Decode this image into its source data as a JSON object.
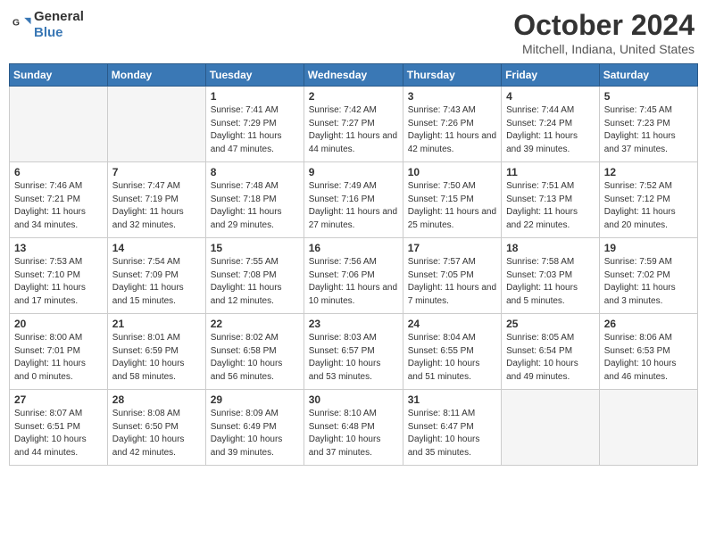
{
  "header": {
    "logo_general": "General",
    "logo_blue": "Blue",
    "title": "October 2024",
    "subtitle": "Mitchell, Indiana, United States"
  },
  "days_of_week": [
    "Sunday",
    "Monday",
    "Tuesday",
    "Wednesday",
    "Thursday",
    "Friday",
    "Saturday"
  ],
  "weeks": [
    [
      {
        "day": "",
        "sunrise": "",
        "sunset": "",
        "daylight": ""
      },
      {
        "day": "",
        "sunrise": "",
        "sunset": "",
        "daylight": ""
      },
      {
        "day": "1",
        "sunrise": "Sunrise: 7:41 AM",
        "sunset": "Sunset: 7:29 PM",
        "daylight": "Daylight: 11 hours and 47 minutes."
      },
      {
        "day": "2",
        "sunrise": "Sunrise: 7:42 AM",
        "sunset": "Sunset: 7:27 PM",
        "daylight": "Daylight: 11 hours and 44 minutes."
      },
      {
        "day": "3",
        "sunrise": "Sunrise: 7:43 AM",
        "sunset": "Sunset: 7:26 PM",
        "daylight": "Daylight: 11 hours and 42 minutes."
      },
      {
        "day": "4",
        "sunrise": "Sunrise: 7:44 AM",
        "sunset": "Sunset: 7:24 PM",
        "daylight": "Daylight: 11 hours and 39 minutes."
      },
      {
        "day": "5",
        "sunrise": "Sunrise: 7:45 AM",
        "sunset": "Sunset: 7:23 PM",
        "daylight": "Daylight: 11 hours and 37 minutes."
      }
    ],
    [
      {
        "day": "6",
        "sunrise": "Sunrise: 7:46 AM",
        "sunset": "Sunset: 7:21 PM",
        "daylight": "Daylight: 11 hours and 34 minutes."
      },
      {
        "day": "7",
        "sunrise": "Sunrise: 7:47 AM",
        "sunset": "Sunset: 7:19 PM",
        "daylight": "Daylight: 11 hours and 32 minutes."
      },
      {
        "day": "8",
        "sunrise": "Sunrise: 7:48 AM",
        "sunset": "Sunset: 7:18 PM",
        "daylight": "Daylight: 11 hours and 29 minutes."
      },
      {
        "day": "9",
        "sunrise": "Sunrise: 7:49 AM",
        "sunset": "Sunset: 7:16 PM",
        "daylight": "Daylight: 11 hours and 27 minutes."
      },
      {
        "day": "10",
        "sunrise": "Sunrise: 7:50 AM",
        "sunset": "Sunset: 7:15 PM",
        "daylight": "Daylight: 11 hours and 25 minutes."
      },
      {
        "day": "11",
        "sunrise": "Sunrise: 7:51 AM",
        "sunset": "Sunset: 7:13 PM",
        "daylight": "Daylight: 11 hours and 22 minutes."
      },
      {
        "day": "12",
        "sunrise": "Sunrise: 7:52 AM",
        "sunset": "Sunset: 7:12 PM",
        "daylight": "Daylight: 11 hours and 20 minutes."
      }
    ],
    [
      {
        "day": "13",
        "sunrise": "Sunrise: 7:53 AM",
        "sunset": "Sunset: 7:10 PM",
        "daylight": "Daylight: 11 hours and 17 minutes."
      },
      {
        "day": "14",
        "sunrise": "Sunrise: 7:54 AM",
        "sunset": "Sunset: 7:09 PM",
        "daylight": "Daylight: 11 hours and 15 minutes."
      },
      {
        "day": "15",
        "sunrise": "Sunrise: 7:55 AM",
        "sunset": "Sunset: 7:08 PM",
        "daylight": "Daylight: 11 hours and 12 minutes."
      },
      {
        "day": "16",
        "sunrise": "Sunrise: 7:56 AM",
        "sunset": "Sunset: 7:06 PM",
        "daylight": "Daylight: 11 hours and 10 minutes."
      },
      {
        "day": "17",
        "sunrise": "Sunrise: 7:57 AM",
        "sunset": "Sunset: 7:05 PM",
        "daylight": "Daylight: 11 hours and 7 minutes."
      },
      {
        "day": "18",
        "sunrise": "Sunrise: 7:58 AM",
        "sunset": "Sunset: 7:03 PM",
        "daylight": "Daylight: 11 hours and 5 minutes."
      },
      {
        "day": "19",
        "sunrise": "Sunrise: 7:59 AM",
        "sunset": "Sunset: 7:02 PM",
        "daylight": "Daylight: 11 hours and 3 minutes."
      }
    ],
    [
      {
        "day": "20",
        "sunrise": "Sunrise: 8:00 AM",
        "sunset": "Sunset: 7:01 PM",
        "daylight": "Daylight: 11 hours and 0 minutes."
      },
      {
        "day": "21",
        "sunrise": "Sunrise: 8:01 AM",
        "sunset": "Sunset: 6:59 PM",
        "daylight": "Daylight: 10 hours and 58 minutes."
      },
      {
        "day": "22",
        "sunrise": "Sunrise: 8:02 AM",
        "sunset": "Sunset: 6:58 PM",
        "daylight": "Daylight: 10 hours and 56 minutes."
      },
      {
        "day": "23",
        "sunrise": "Sunrise: 8:03 AM",
        "sunset": "Sunset: 6:57 PM",
        "daylight": "Daylight: 10 hours and 53 minutes."
      },
      {
        "day": "24",
        "sunrise": "Sunrise: 8:04 AM",
        "sunset": "Sunset: 6:55 PM",
        "daylight": "Daylight: 10 hours and 51 minutes."
      },
      {
        "day": "25",
        "sunrise": "Sunrise: 8:05 AM",
        "sunset": "Sunset: 6:54 PM",
        "daylight": "Daylight: 10 hours and 49 minutes."
      },
      {
        "day": "26",
        "sunrise": "Sunrise: 8:06 AM",
        "sunset": "Sunset: 6:53 PM",
        "daylight": "Daylight: 10 hours and 46 minutes."
      }
    ],
    [
      {
        "day": "27",
        "sunrise": "Sunrise: 8:07 AM",
        "sunset": "Sunset: 6:51 PM",
        "daylight": "Daylight: 10 hours and 44 minutes."
      },
      {
        "day": "28",
        "sunrise": "Sunrise: 8:08 AM",
        "sunset": "Sunset: 6:50 PM",
        "daylight": "Daylight: 10 hours and 42 minutes."
      },
      {
        "day": "29",
        "sunrise": "Sunrise: 8:09 AM",
        "sunset": "Sunset: 6:49 PM",
        "daylight": "Daylight: 10 hours and 39 minutes."
      },
      {
        "day": "30",
        "sunrise": "Sunrise: 8:10 AM",
        "sunset": "Sunset: 6:48 PM",
        "daylight": "Daylight: 10 hours and 37 minutes."
      },
      {
        "day": "31",
        "sunrise": "Sunrise: 8:11 AM",
        "sunset": "Sunset: 6:47 PM",
        "daylight": "Daylight: 10 hours and 35 minutes."
      },
      {
        "day": "",
        "sunrise": "",
        "sunset": "",
        "daylight": ""
      },
      {
        "day": "",
        "sunrise": "",
        "sunset": "",
        "daylight": ""
      }
    ]
  ]
}
